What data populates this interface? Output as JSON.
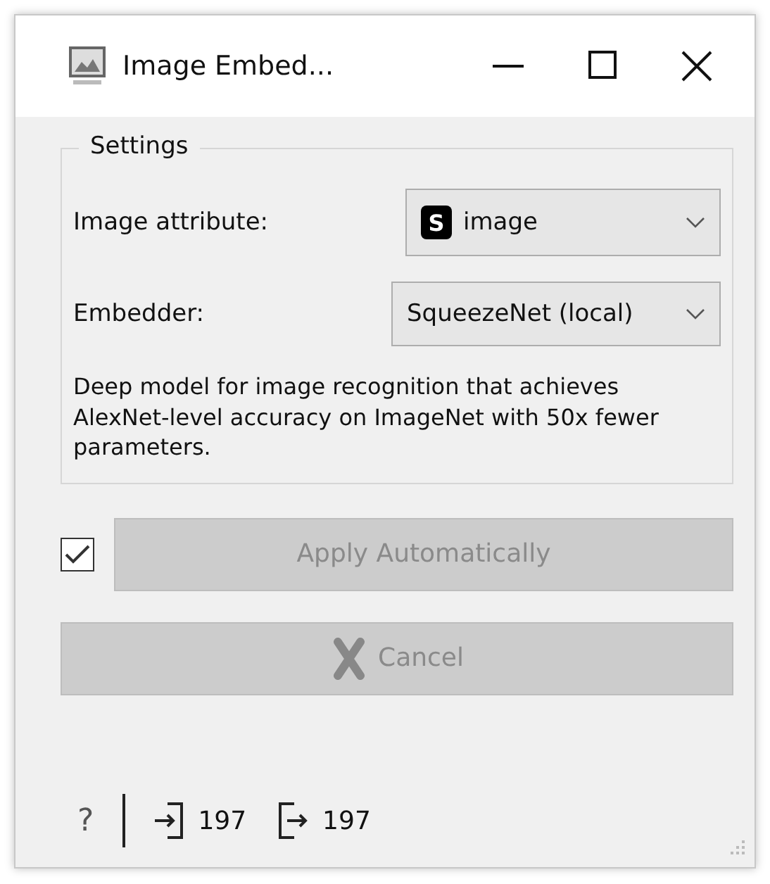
{
  "window": {
    "title": "Image Embed..."
  },
  "settings": {
    "title": "Settings",
    "image_attribute": {
      "label": "Image attribute:",
      "type_badge": "S",
      "value": "image"
    },
    "embedder": {
      "label": "Embedder:",
      "value": "SqueezeNet (local)"
    },
    "description": "Deep model for image recognition that achieves AlexNet-level accuracy on ImageNet with 50x fewer parameters."
  },
  "auto_apply": {
    "checked": true,
    "label": "Apply Automatically",
    "disabled": true
  },
  "cancel": {
    "label": "Cancel",
    "disabled": true
  },
  "status_bar": {
    "help": "?",
    "input_count": "197",
    "output_count": "197"
  }
}
